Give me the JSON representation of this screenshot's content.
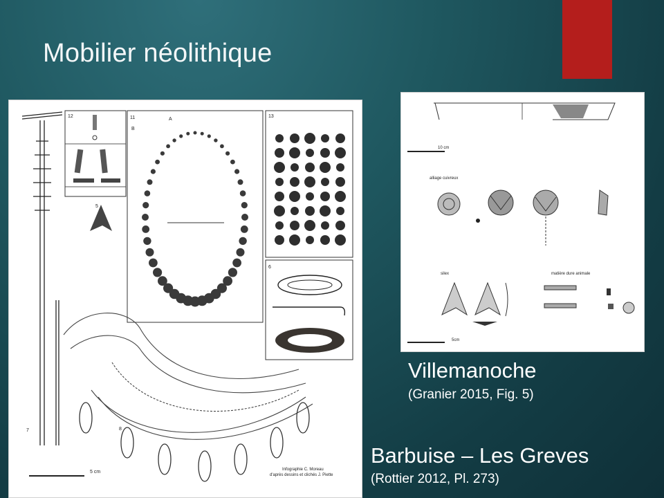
{
  "slide": {
    "title": "Mobilier néolithique",
    "accent_color": "#b41e1c",
    "background_color": "#1f5860"
  },
  "left_figure": {
    "caption_main": "Barbuise – Les Greves",
    "caption_sub": "(Rottier 2012, Pl. 273)",
    "panel_numbers": [
      "12",
      "11",
      "13",
      "5",
      "6",
      "7",
      "8"
    ],
    "view_letters": [
      "A",
      "B"
    ],
    "scale_label": "5 cm",
    "credit_line1": "Infographie C. Moreau",
    "credit_line2": "d'après dessins et clichés J. Piette"
  },
  "right_figure": {
    "caption_main": "Villemanoche",
    "caption_sub": "(Granier 2015, Fig. 5)",
    "scale_top": "10 cm",
    "scale_bottom": "5cm",
    "label_metal": "alliage cuivreux",
    "label_flint": "silex",
    "label_bone": "matière dure animale"
  }
}
